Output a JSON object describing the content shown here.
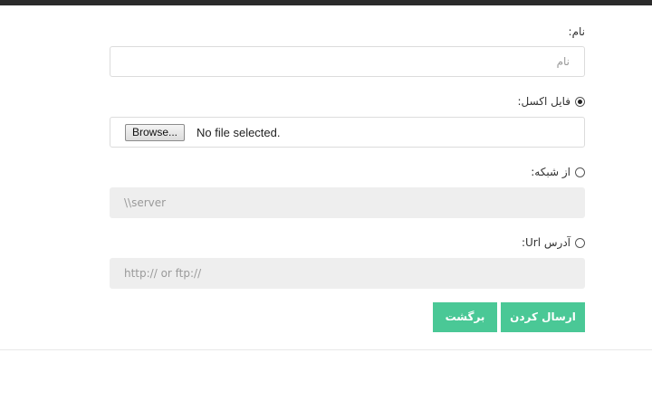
{
  "form": {
    "name_label": "نام:",
    "name_placeholder": "نام",
    "excel_label": "فایل اکسل:",
    "excel_selected": true,
    "browse_label": "Browse...",
    "file_status": "No file selected.",
    "network_label": "از شبکه:",
    "network_selected": false,
    "network_placeholder": "\\\\server",
    "url_label": "آدرس Url:",
    "url_selected": false,
    "url_placeholder": "http:// or ftp://"
  },
  "actions": {
    "submit_label": "ارسال کردن",
    "back_label": "برگشت"
  },
  "colors": {
    "button": "#4ac896",
    "disabled_field": "#eeeeee",
    "topbar": "#2b2b2b"
  }
}
